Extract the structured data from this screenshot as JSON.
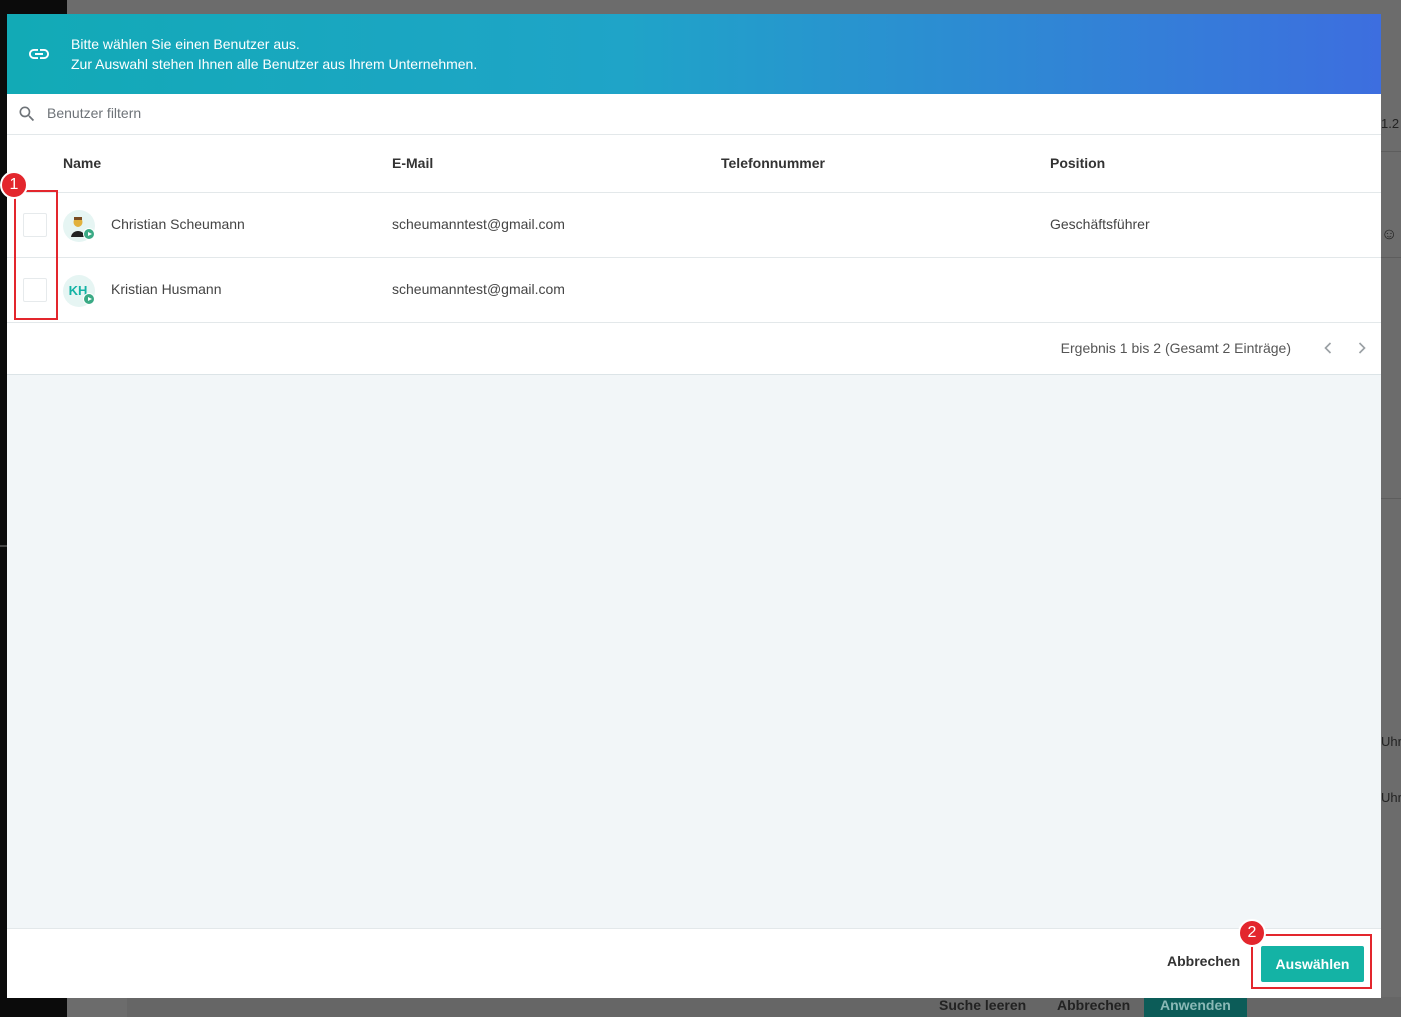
{
  "background": {
    "right_texts": [
      "1.2",
      "☺",
      "Uhr",
      "Uhr"
    ],
    "bottom_buttons": {
      "clear": "Suche leeren",
      "cancel": "Abbrechen",
      "apply": "Anwenden"
    }
  },
  "dialog": {
    "header": {
      "icon": "link-icon",
      "line1": "Bitte wählen Sie einen Benutzer aus.",
      "line2": "Zur Auswahl stehen Ihnen alle Benutzer aus Ihrem Unternehmen."
    },
    "search": {
      "icon": "search-icon",
      "placeholder": "Benutzer filtern",
      "value": ""
    },
    "table": {
      "columns": [
        "Name",
        "E-Mail",
        "Telefonnummer",
        "Position"
      ],
      "rows": [
        {
          "name": "Christian Scheumann",
          "email": "scheumanntest@gmail.com",
          "phone": "",
          "position": "Geschäftsführer",
          "avatar": "photo",
          "initials": "",
          "checked": false
        },
        {
          "name": "Kristian Husmann",
          "email": "scheumanntest@gmail.com",
          "phone": "",
          "position": "",
          "avatar": "initials",
          "initials": "KH",
          "checked": false
        }
      ]
    },
    "pagination": {
      "result_text": "Ergebnis 1 bis 2 (Gesamt 2 Einträge)",
      "prev_icon": "chevron-left-icon",
      "next_icon": "chevron-right-icon"
    },
    "footer": {
      "cancel_label": "Abbrechen",
      "select_label": "Auswählen"
    }
  },
  "annotations": [
    {
      "label": "1"
    },
    {
      "label": "2"
    }
  ],
  "colors": {
    "accent": "#14b3a5",
    "header_start": "#12aab6",
    "header_end": "#3d6edf",
    "annotation": "#e3262d"
  }
}
